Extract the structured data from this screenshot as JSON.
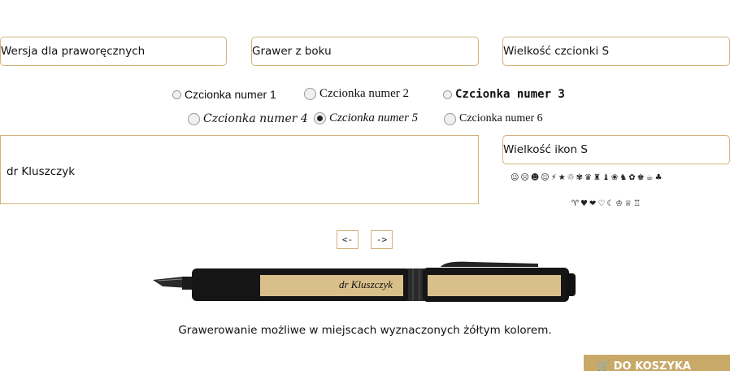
{
  "selects": {
    "hand_version": "Wersja dla praworęcznych",
    "engrave_side": "Grawer z boku",
    "font_size": "Wielkość czcionki S",
    "icon_size": "Wielkość ikon S"
  },
  "fonts": [
    {
      "label": "Czcionka numer 1",
      "checked": false
    },
    {
      "label": "Czcionka numer 2",
      "checked": false
    },
    {
      "label": "Czcionka numer 3",
      "checked": false
    },
    {
      "label": "Czcionka numer 4",
      "checked": false
    },
    {
      "label": "Czcionka numer 5",
      "checked": true
    },
    {
      "label": "Czcionka numer 6",
      "checked": false
    }
  ],
  "engraving_text": "dr Kluszczyk",
  "icons": {
    "row1": "☺☹☻☺⚡★♲✾♛♜♝❀♞✿♚☕♣",
    "row2": "♈♥❤♡☾♔♕♖"
  },
  "nav": {
    "prev": "<-",
    "next": "->"
  },
  "pen_preview_text": "dr Kluszczyk",
  "note": "Grawerowanie możliwe w miejscach wyznaczonych żółtym kolorem.",
  "cart_button": "DO KOSZYKA",
  "colors": {
    "accent": "#d2b47a",
    "gold_panel": "#d9c08a",
    "button": "#c8a968"
  }
}
